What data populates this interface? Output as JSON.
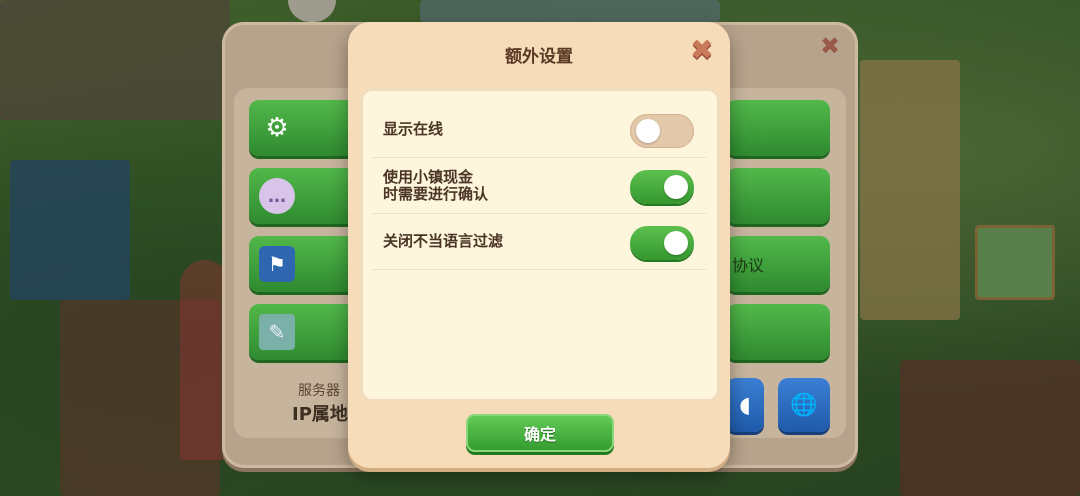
{
  "dialog": {
    "title": "额外设置",
    "close_icon": "close-x-icon",
    "settings": [
      {
        "label": "显示在线",
        "enabled": false
      },
      {
        "label": "使用小镇现金\n时需要进行确认",
        "enabled": true
      },
      {
        "label": "关闭不当语言过滤",
        "enabled": true
      }
    ],
    "confirm_label": "确定"
  },
  "background_panel": {
    "server_label": "服务器",
    "ip_label": "IP属地",
    "right_button_text": "协议",
    "left_button_icons": [
      "gear-icon",
      "chat-bubble-icon",
      "checkered-flag-icon",
      "document-icon"
    ],
    "bottom_button_icons": [
      "sound-icon",
      "globe-icon"
    ]
  },
  "colors": {
    "dialog_bg": "#f6dcb8",
    "content_bg": "#fdf5dc",
    "toggle_on": "#4caf42",
    "toggle_off": "#e4c8aa",
    "confirm_button": "#4cb840",
    "title_text": "#5a3a24"
  }
}
